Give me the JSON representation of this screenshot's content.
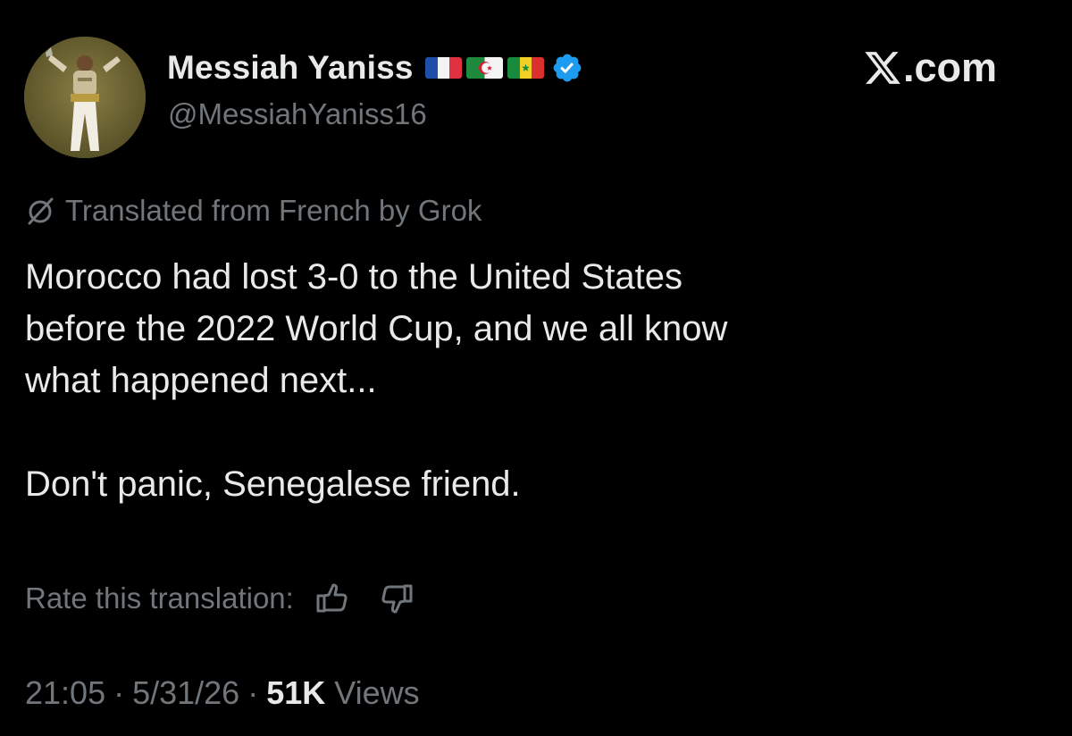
{
  "author": {
    "display_name": "Messiah Yaniss",
    "handle": "@MessiahYaniss16",
    "flags": [
      "france-flag",
      "algeria-flag",
      "senegal-flag"
    ],
    "verified_icon": "verified-badge-icon",
    "avatar": "avatar-photo"
  },
  "brand": {
    "logo_icon": "x-logo-icon",
    "text": ".com"
  },
  "translation": {
    "icon": "grok-icon",
    "label": "Translated from French by Grok",
    "rate_label": "Rate this translation:",
    "rate_up_icon": "thumbs-up-icon",
    "rate_down_icon": "thumbs-down-icon"
  },
  "tweet": {
    "lines": [
      "Morocco had lost 3-0 to the United States",
      "before the 2022 World Cup, and we all know",
      "what happened next..."
    ],
    "closing": "Don't panic, Senegalese friend."
  },
  "meta": {
    "time": "21:05",
    "separator": "·",
    "date": "5/31/26",
    "views_count": "51K",
    "views_label": "Views"
  },
  "colors": {
    "background": "#000000",
    "text_primary": "#e7e9ea",
    "text_secondary": "#71767b",
    "verified_blue": "#1d9bf0"
  }
}
